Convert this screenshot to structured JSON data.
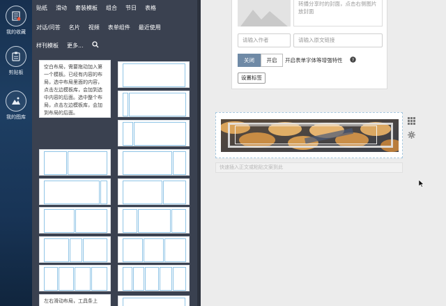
{
  "rail": {
    "items": [
      {
        "label": "我的收藏",
        "icon": "save-list-icon"
      },
      {
        "label": "剪贴板",
        "icon": "clipboard-icon"
      },
      {
        "label": "我的图库",
        "icon": "gallery-icon"
      }
    ]
  },
  "panel": {
    "tabs_row1": [
      "贴纸",
      "滑动",
      "套装模板",
      "组合",
      "节日",
      "表格"
    ],
    "tabs_row2": [
      "对话/问答",
      "名片",
      "视频",
      "表单组件",
      "最近使用"
    ],
    "tabs_row3": [
      "样刊模板",
      "更多..."
    ],
    "search_icon": "search-icon",
    "card_text_1": "空白布局，需要拖动加入第一个模板。已经有内容的布局，选中布局里面的内容，点击左边模板库，会加到选中内容的后面。选中整个布局，点击左边模板库，会加到布局的后面。",
    "card_text_2": "左右滑动布局，工具条上"
  },
  "form": {
    "cover_hint": "转播分享时的封面，点击右侧图片放封面",
    "author_placeholder": "请输入作者",
    "source_placeholder": "请输入原文链接",
    "toggle_off": "关闭",
    "toggle_on": "开启",
    "enhance_label": "开启表单字体等增强特性",
    "help_icon": "question-circle-icon",
    "tags_button": "设置标签"
  },
  "editor": {
    "drop_placeholder": "快速插入正文或粘贴文案到此",
    "grid_icon": "drag-grid-icon",
    "gear_icon": "gear-icon"
  },
  "colors": {
    "rail": "#1e3f63",
    "panel": "#3a4150",
    "cell_border": "#8fc4e6",
    "toggle_active": "#6f8aa6"
  }
}
